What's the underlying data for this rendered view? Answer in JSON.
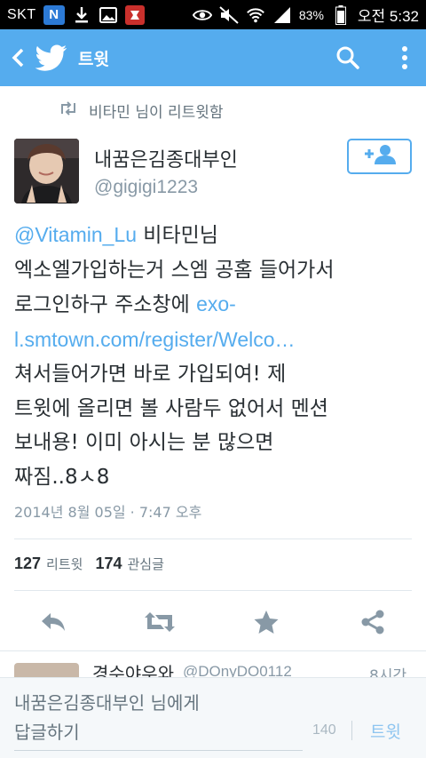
{
  "status_bar": {
    "carrier": "SKT",
    "n_badge": "N",
    "battery": "83%",
    "time": "오전 5:32"
  },
  "app_bar": {
    "title": "트윗",
    "background": "#55acee",
    "icons": [
      "back-arrow-icon",
      "twitter-bird-icon",
      "search-icon",
      "more-vert-icon"
    ]
  },
  "tweet": {
    "retweet_context": "비타민 님이 리트윗함",
    "author_name": "내꿈은김종대부인",
    "author_handle": "@gigigi1223",
    "text_lines": [
      {
        "pre": "",
        "link": "@Vitamin_Lu",
        "post": " 비타민님"
      },
      {
        "pre": "엑소엘가입하는거 스엠 공홈 들어가서",
        "link": "",
        "post": ""
      },
      {
        "pre": "로그인하구 주소창에 ",
        "link": "exo-",
        "post": ""
      },
      {
        "pre": "",
        "link": "l.smtown.com/register/Welco…",
        "post": ""
      },
      {
        "pre": "쳐서들어가면 바로 가입되여! 제",
        "link": "",
        "post": ""
      },
      {
        "pre": "트윗에 올리면 볼 사람두 없어서 멘션",
        "link": "",
        "post": ""
      },
      {
        "pre": "보내용! 이미 아시는 분 많으면",
        "link": "",
        "post": ""
      },
      {
        "pre": "짜짐..8ㅅ8",
        "link": "",
        "post": ""
      }
    ],
    "date": "2014년 8월 05일 · 7:47 오후",
    "retweet_count": "127",
    "retweet_label": "리트윗",
    "like_count": "174",
    "like_label": "관심글",
    "accent_color": "#55acee"
  },
  "next_item": {
    "name": "경수야우와",
    "handle": "@DOnyDO0112",
    "time": "8시간"
  },
  "reply_bar": {
    "placeholder_line1": "내꿈은김종대부인 님에게",
    "placeholder_line2": "답글하기",
    "char_count": "140",
    "send_label": "트윗"
  }
}
